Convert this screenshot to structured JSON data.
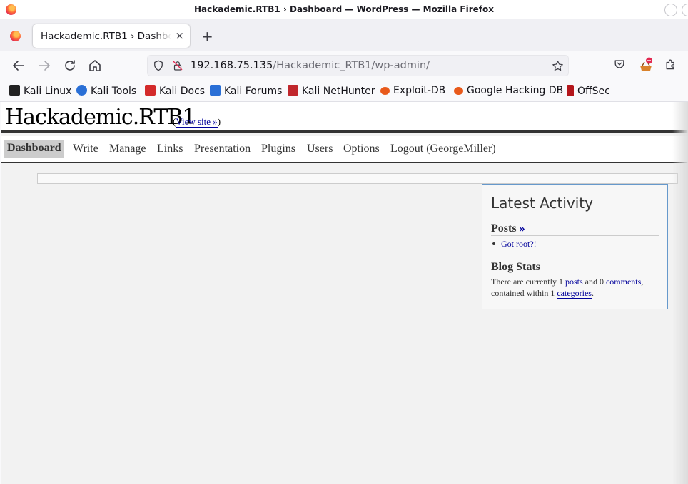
{
  "window": {
    "title": "Hackademic.RTB1 › Dashboard — WordPress — Mozilla Firefox"
  },
  "tabs": [
    {
      "label": "Hackademic.RTB1 › Dashboard",
      "close": "×"
    }
  ],
  "new_tab_label": "+",
  "url": {
    "host": "192.168.75.135",
    "path": "/Hackademic_RTB1/wp-admin/"
  },
  "bookmarks": [
    {
      "label": "Kali Linux",
      "icon": "kali-dragon-icon",
      "color": "#222222"
    },
    {
      "label": "Kali Tools",
      "icon": "kali-tools-icon",
      "color": "#2a6fd6"
    },
    {
      "label": "Kali Docs",
      "icon": "kali-docs-icon",
      "color": "#d32a2a"
    },
    {
      "label": "Kali Forums",
      "icon": "kali-forums-icon",
      "color": "#2a6fd6"
    },
    {
      "label": "Kali NetHunter",
      "icon": "kali-nethunter-icon",
      "color": "#c0262c"
    },
    {
      "label": "Exploit-DB",
      "icon": "exploit-db-icon",
      "color": "#e8591a"
    },
    {
      "label": "Google Hacking DB",
      "icon": "ghdb-icon",
      "color": "#e8591a"
    },
    {
      "label": "OffSec",
      "icon": "offsec-icon",
      "color": "#b4161b"
    }
  ],
  "wp": {
    "site_title": "Hackademic.RTB1",
    "view_site_prefix": "(",
    "view_site_label": "View site »",
    "view_site_suffix": ")",
    "menu": [
      {
        "label": "Dashboard",
        "current": true
      },
      {
        "label": "Write"
      },
      {
        "label": "Manage"
      },
      {
        "label": "Links"
      },
      {
        "label": "Presentation"
      },
      {
        "label": "Plugins"
      },
      {
        "label": "Users"
      },
      {
        "label": "Options"
      },
      {
        "label": "Logout (GeorgeMiller)"
      }
    ],
    "latest_activity": {
      "heading": "Latest Activity",
      "posts_heading": "Posts",
      "posts_more": "»",
      "posts": [
        "Got root?!"
      ],
      "stats_heading": "Blog Stats",
      "stats": {
        "t1": "There are currently 1 ",
        "posts_link": "posts",
        "t2": " and 0 ",
        "comments_link": "comments",
        "t3": ", contained within 1 ",
        "categories_link": "categories",
        "t4": "."
      }
    }
  },
  "colors": {
    "link": "#00019b",
    "box_border": "#6699cc",
    "header_rule": "#333333"
  }
}
